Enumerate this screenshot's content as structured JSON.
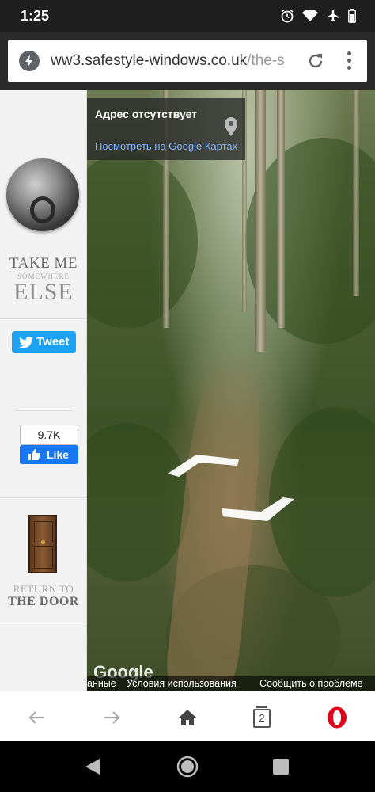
{
  "status_bar": {
    "time": "1:25",
    "icons": [
      "alarm-icon",
      "wifi-icon",
      "airplane-icon",
      "battery-icon"
    ]
  },
  "url_bar": {
    "url_main": "ww3.safestyle-windows.co.uk",
    "url_rest": "/the-s",
    "icons": [
      "lightning-icon",
      "reload-icon",
      "menu-dots-icon"
    ]
  },
  "sidebar": {
    "take_me_line1": "TAKE ME",
    "take_me_line2": "SOMEWHERE",
    "take_me_line3": "ELSE",
    "tweet_label": "Tweet",
    "like_count": "9.7K",
    "like_label": "Like",
    "return_line1": "RETURN TO",
    "return_line2": "THE DOOR"
  },
  "streetview": {
    "info_title": "Адрес отсутствует",
    "info_link": "Посмотреть на Google Картах",
    "google_logo": "Google",
    "footer_data": "анные",
    "footer_terms": "Условия использования",
    "footer_report": "Сообщить о проблеме"
  },
  "bottom_bar": {
    "tab_count": "2",
    "icons": [
      "back-arrow-icon",
      "forward-arrow-icon",
      "home-icon",
      "tabs-icon",
      "opera-icon"
    ]
  },
  "colors": {
    "tweet": "#1da1f2",
    "like": "#1877f2",
    "opera": "#e3001b",
    "link": "#7fb3ff"
  }
}
